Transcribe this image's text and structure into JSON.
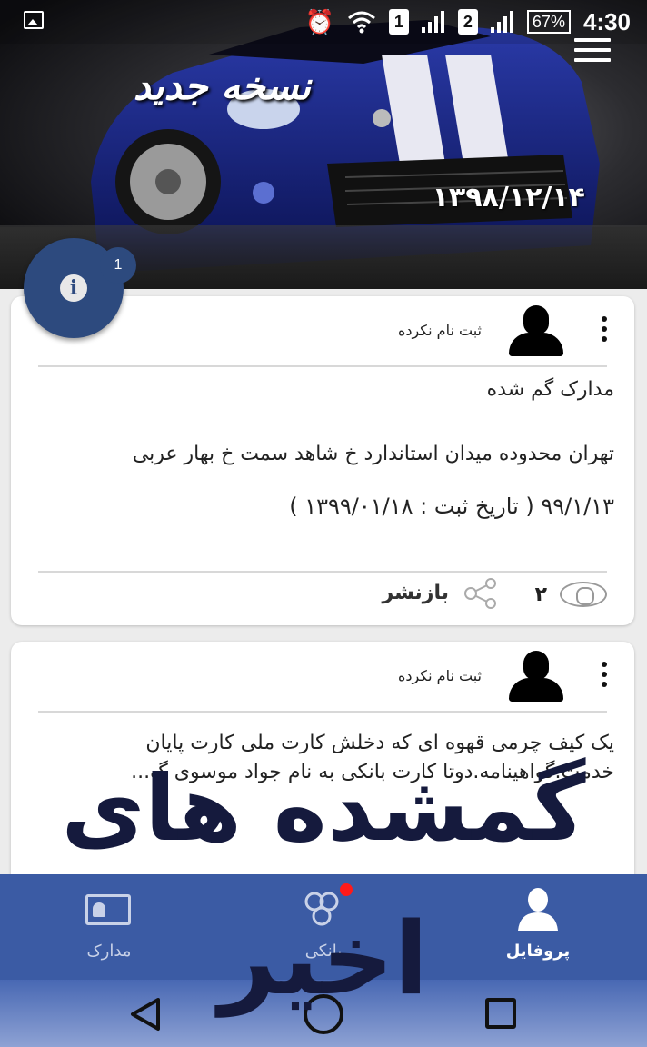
{
  "status_bar": {
    "battery": "67%",
    "time": "4:30",
    "sim1": "1",
    "sim2": "2"
  },
  "header": {
    "app_title": "نسخه جدید",
    "date": "۱۳۹۸/۱۲/۱۴",
    "info_badge_count": "1"
  },
  "posts": [
    {
      "user": "ثبت نام نکرده",
      "title": "مدارک گم شده",
      "address": "تهران محدوده میدان استاندارد خ شاهد  سمت خ بهار عربی",
      "date_line": "۹۹/۱/۱۳  ( تاریخ ثبت : ۱۳۹۹/۰۱/۱۸ )",
      "views": "۲",
      "share_label": "بازنشر"
    },
    {
      "user": "ثبت نام نکرده",
      "description": "یک کیف چرمی قهوه ای که دخلش کارت ملی کارت پایان خدمت.گواهینامه.دوتا کارت بانکی به نام جواد موسوی گ..."
    }
  ],
  "overlay": {
    "line1": "گمشده های",
    "line2": "اخیر"
  },
  "bottom_nav": {
    "docs_label": "مدارک",
    "recent_label": "بانکی",
    "profile_label": "پروفایل"
  },
  "colors": {
    "nav_bg": "#3b5ba4",
    "fab_bg": "#2d4a7e",
    "overlay_text": "#151a3d",
    "badge_dot": "#ff1a1a"
  }
}
